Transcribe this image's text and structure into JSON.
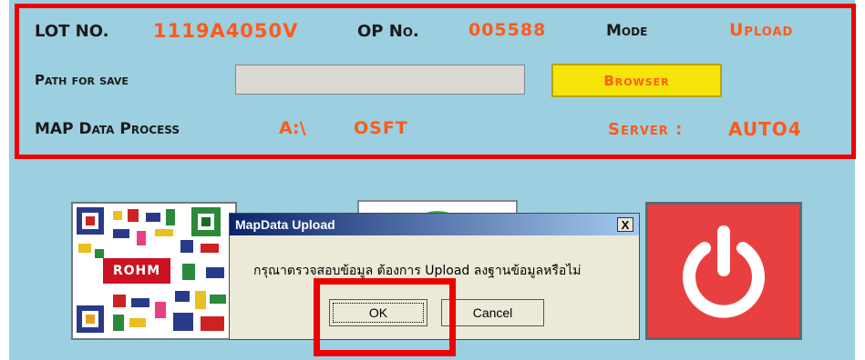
{
  "header": {
    "lot_label": "LOT NO.",
    "lot_value": "1119A4050V",
    "op_label": "OP No.",
    "op_value": "005588",
    "mode_label": "Mode",
    "mode_value": "Upload",
    "path_label": "Path for save",
    "path_value": "",
    "browse_label": "Browser",
    "map_label": "MAP Data Process",
    "map_drive": "A:\\",
    "map_folder": "OSFT",
    "server_label": "Server :",
    "server_value": "AUTO4"
  },
  "tiles": {
    "qr_logo_text": "ROHM"
  },
  "dialog": {
    "title": "MapData Upload",
    "close_label": "X",
    "message": "กรุณาตรวจสอบข้อมูล  ต้องการ Upload ลงฐานข้อมูลหรือไม่",
    "ok_label": "OK",
    "cancel_label": "Cancel"
  },
  "colors": {
    "background": "#9ccfe0",
    "value_orange": "#ff5a1a",
    "highlight_red": "#ee0000",
    "browse_yellow": "#f5e50a",
    "power_red": "#e84040"
  },
  "icons": [
    "qr-code-icon",
    "power-icon",
    "close-icon"
  ]
}
